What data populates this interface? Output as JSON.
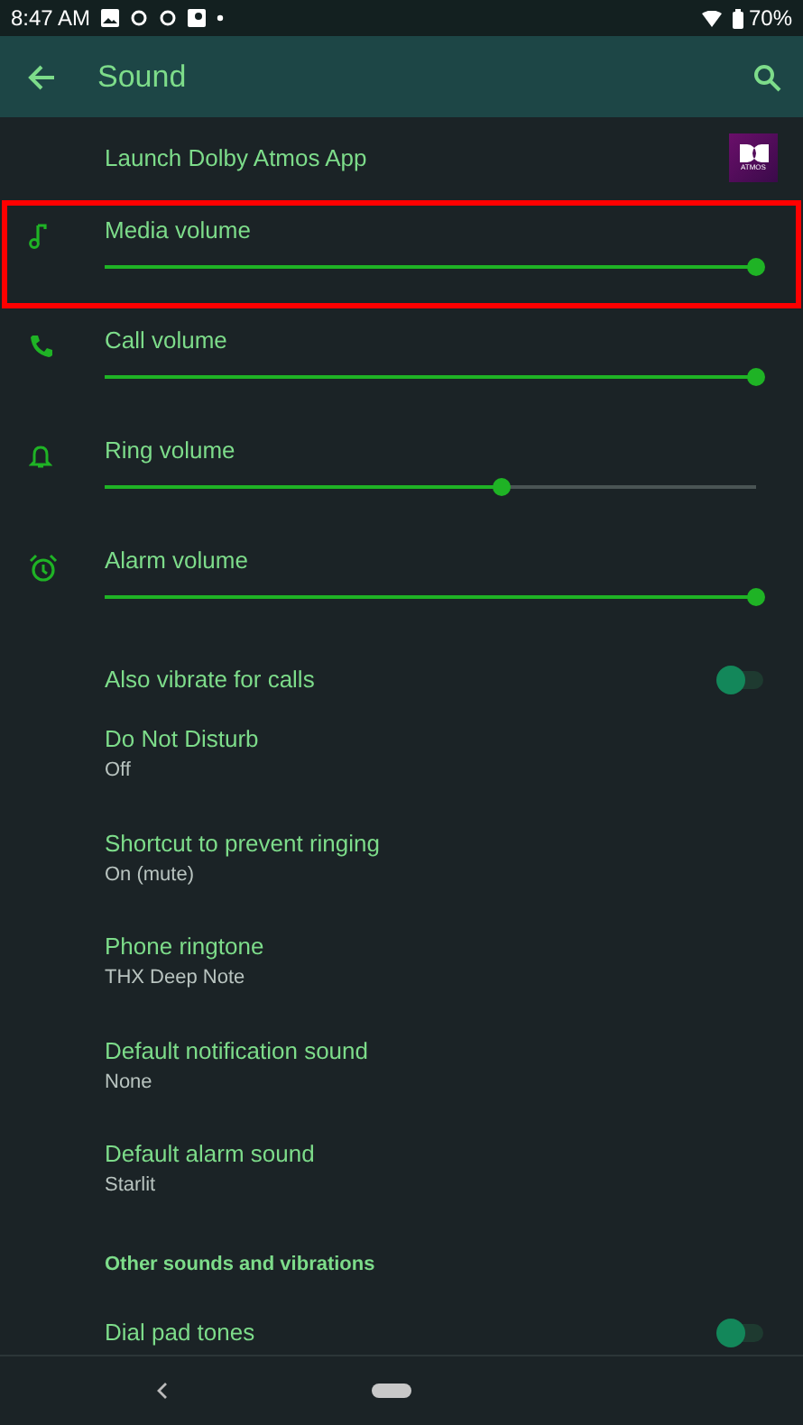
{
  "status_bar": {
    "time": "8:47 AM",
    "battery": "70%"
  },
  "toolbar": {
    "title": "Sound"
  },
  "items": [
    {
      "kind": "link",
      "title": "Launch Dolby Atmos App",
      "logo_text": "ATMOS"
    },
    {
      "kind": "slider",
      "title": "Media volume",
      "level": 1.0,
      "highlighted": true
    },
    {
      "kind": "slider",
      "title": "Call volume",
      "level": 1.0,
      "highlighted": false
    },
    {
      "kind": "slider",
      "title": "Ring volume",
      "level": 0.61,
      "highlighted": false
    },
    {
      "kind": "slider",
      "title": "Alarm volume",
      "level": 1.0,
      "highlighted": false
    },
    {
      "kind": "switch",
      "title": "Also vibrate for calls",
      "on": false
    },
    {
      "kind": "text",
      "title": "Do Not Disturb",
      "summary": "Off"
    },
    {
      "kind": "text",
      "title": "Shortcut to prevent ringing",
      "summary": "On (mute)"
    },
    {
      "kind": "text",
      "title": "Phone ringtone",
      "summary": "THX Deep Note"
    },
    {
      "kind": "text",
      "title": "Default notification sound",
      "summary": "None"
    },
    {
      "kind": "text",
      "title": "Default alarm sound",
      "summary": "Starlit"
    },
    {
      "kind": "category",
      "title": "Other sounds and vibrations"
    },
    {
      "kind": "switch",
      "title": "Dial pad tones",
      "on": false
    }
  ]
}
